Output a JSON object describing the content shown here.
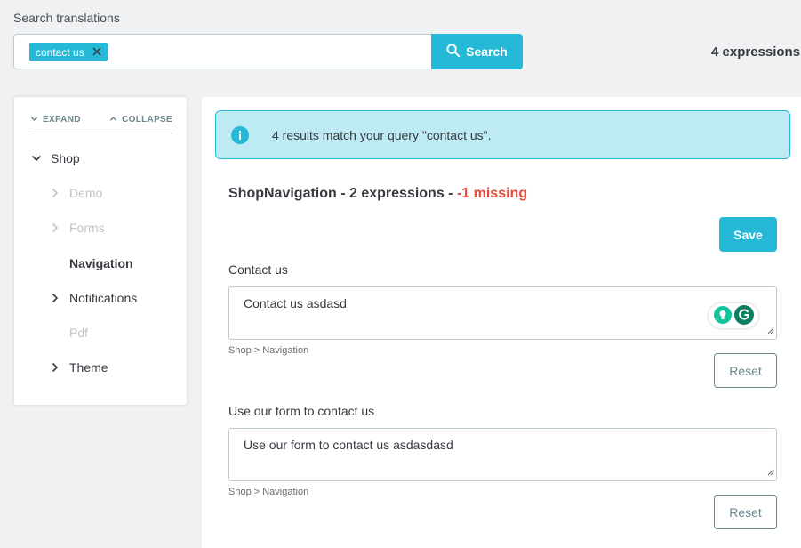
{
  "search": {
    "label": "Search translations",
    "tag": "contact us",
    "button_label": "Search"
  },
  "summary": {
    "expressions": "4 expressions"
  },
  "sidebar": {
    "expand_label": "EXPAND",
    "collapse_label": "COLLAPSE",
    "items": [
      {
        "label": "Shop",
        "state": "expanded"
      },
      {
        "label": "Demo",
        "state": "disabled"
      },
      {
        "label": "Forms",
        "state": "disabled"
      },
      {
        "label": "Navigation",
        "state": "selected"
      },
      {
        "label": "Notifications",
        "state": "collapsed"
      },
      {
        "label": "Pdf",
        "state": "disabled"
      },
      {
        "label": "Theme",
        "state": "collapsed"
      }
    ]
  },
  "main": {
    "alert": "4 results match your query \"contact us\".",
    "section_title": "ShopNavigation - 2 expressions - ",
    "section_missing": "-1 missing",
    "save_label": "Save",
    "fields": [
      {
        "label": "Contact us",
        "value": "Contact us asdasd",
        "breadcrumb": "Shop > Navigation",
        "reset_label": "Reset"
      },
      {
        "label": "Use our form to contact us",
        "value": "Use our form to contact us asdasdasd",
        "breadcrumb": "Shop > Navigation",
        "reset_label": "Reset"
      }
    ]
  },
  "colors": {
    "accent": "#25b9d7",
    "alert_bg": "#beeaf3",
    "missing": "#e84b3c",
    "page_bg": "#eff1f2"
  },
  "icons": [
    "close-icon",
    "search-icon",
    "chevron-down-icon",
    "chevron-up-icon",
    "chevron-right-icon",
    "info-icon",
    "grammarly-icon",
    "resize-handle-icon"
  ]
}
